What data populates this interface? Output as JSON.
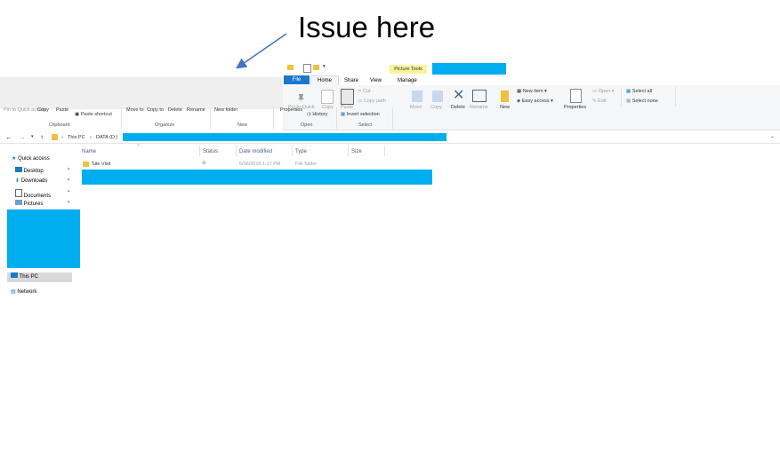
{
  "annotation": {
    "text": "Issue here"
  },
  "ribbon": {
    "contextual_tab": "Picture Tools",
    "tabs": {
      "file": "File",
      "home": "Home",
      "share": "Share",
      "view": "View",
      "manage": "Manage"
    },
    "clipboard": {
      "pin": "Pin to Quick access",
      "copy": "Copy",
      "paste": "Paste",
      "paste_shortcut": "Paste shortcut",
      "group": "Clipboard"
    },
    "organize": {
      "move_to": "Move to",
      "copy_to": "Copy to",
      "delete": "Delete",
      "rename": "Rename",
      "group": "Organize"
    },
    "new": {
      "new_folder": "New folder",
      "group": "New",
      "new_item": "New item",
      "easy_access": "Easy access",
      "new_btn": "New"
    },
    "open": {
      "properties": "Properties",
      "group": "Open",
      "open": "Open",
      "edit": "Edit",
      "history": "History"
    },
    "select": {
      "select_all": "Select all",
      "select_none": "Select none",
      "invert": "Invert selection",
      "group": "Select"
    },
    "home_group": {
      "pin": "Pin to Quick",
      "copy": "Copy",
      "paste": "Paste",
      "cut": "Cut",
      "copy_path": "Copy path",
      "move": "Move",
      "copy2": "Copy",
      "delete": "Delete",
      "rename": "Rename",
      "properties": "Properties"
    }
  },
  "address": {
    "this_pc": "This PC",
    "drive": "DATA (D:)"
  },
  "columns": {
    "name": "Name",
    "status": "Status",
    "date": "Date modified",
    "type": "Type",
    "size": "Size"
  },
  "files": [
    {
      "name": "Site Visit",
      "date": "6/06/2018 1:17 PM",
      "type": "File folder"
    }
  ],
  "nav": {
    "quick_access": "Quick access",
    "desktop": "Desktop",
    "downloads": "Downloads",
    "documents": "Documents",
    "pictures": "Pictures",
    "this_pc": "This PC",
    "network": "Network"
  },
  "colors": {
    "accent": "#1979ca",
    "redaction": "#00aeef",
    "contextual": "#f7f39a",
    "arrow": "#4472c4"
  }
}
